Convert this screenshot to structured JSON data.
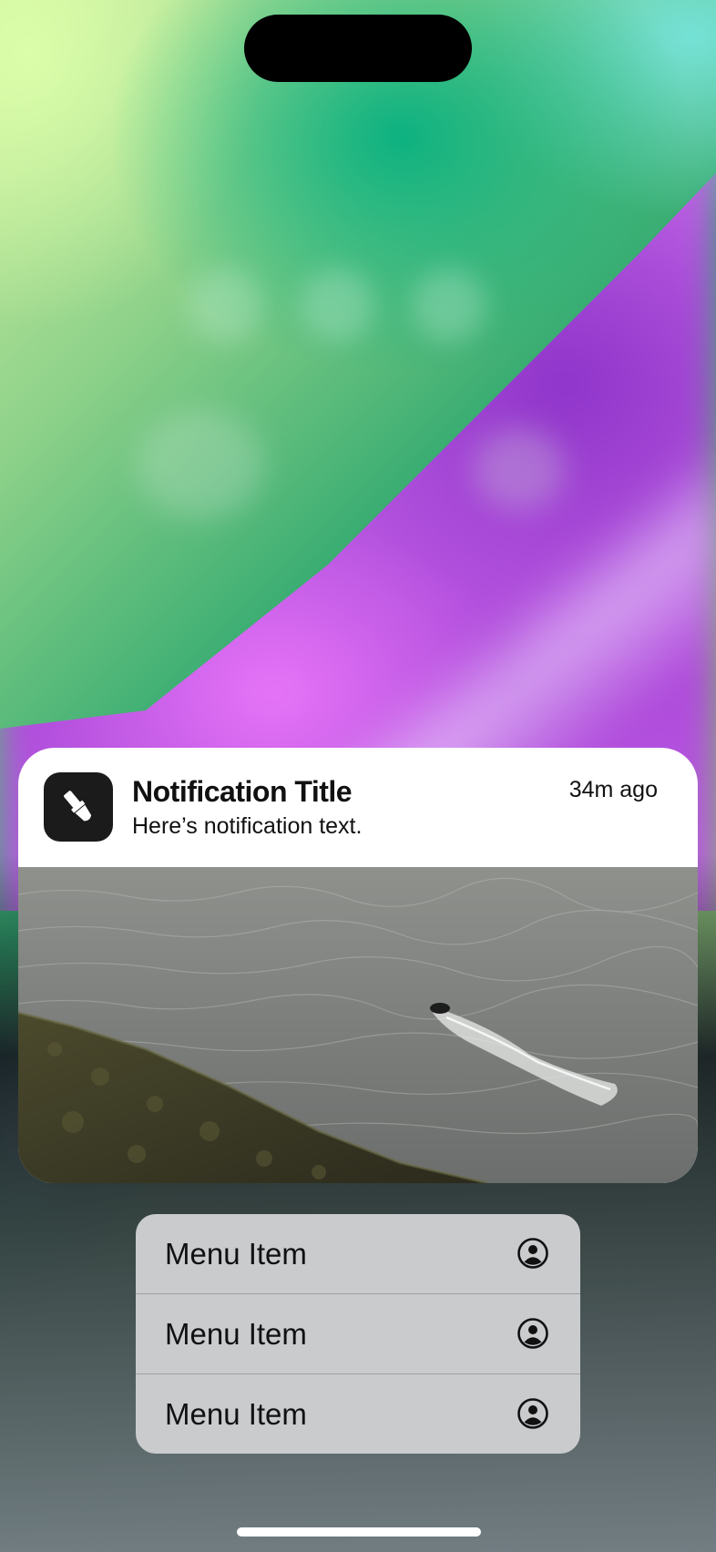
{
  "notification": {
    "title": "Notification Title",
    "text": "Here’s notification text.",
    "time": "34m ago",
    "app_icon": "paintbrush-icon",
    "image": "aerial-sea-boat-photo"
  },
  "menu": {
    "items": [
      {
        "label": "Menu Item",
        "icon": "person-circle-icon"
      },
      {
        "label": "Menu Item",
        "icon": "person-circle-icon"
      },
      {
        "label": "Menu Item",
        "icon": "person-circle-icon"
      }
    ]
  },
  "colors": {
    "menu_background": "#c9cbcd",
    "notification_background": "#ffffff",
    "app_icon_background": "#1b1b1b"
  }
}
